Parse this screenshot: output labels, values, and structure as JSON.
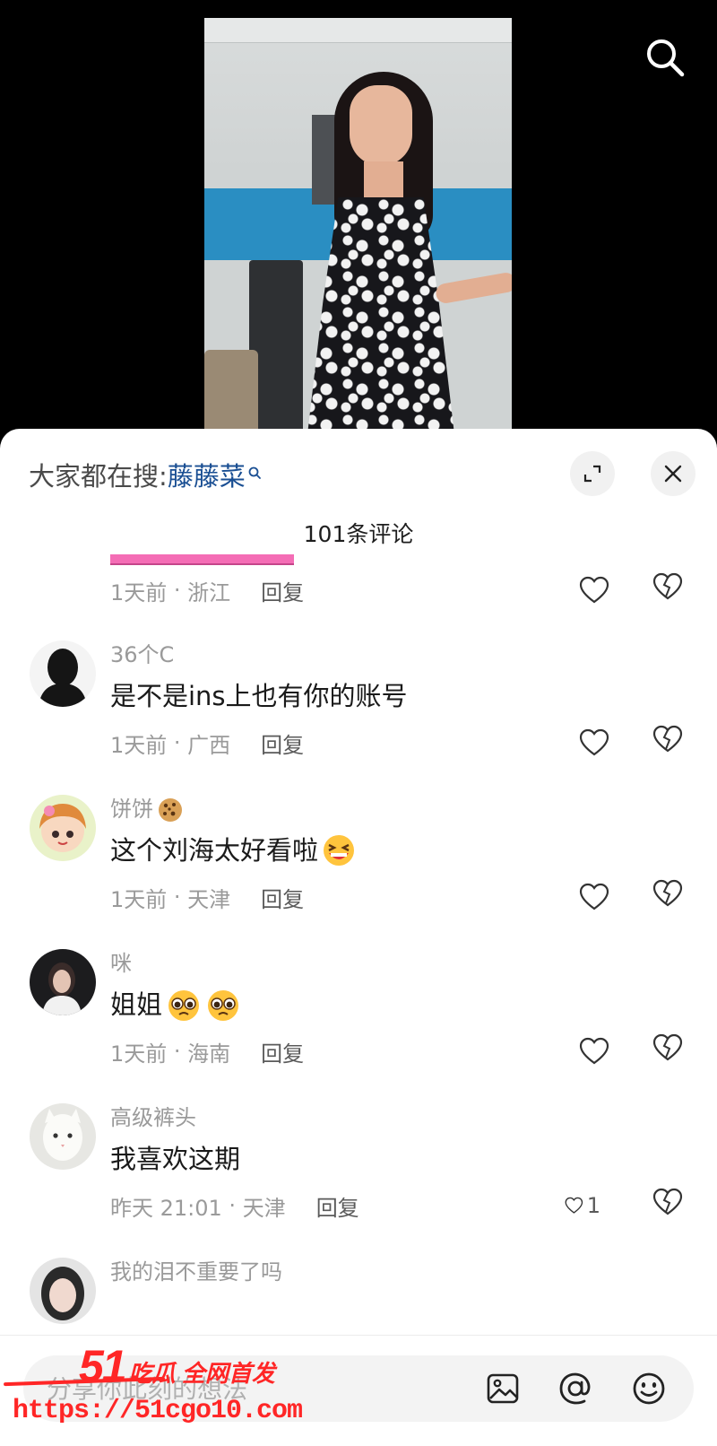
{
  "video": {
    "search_icon": "search-icon"
  },
  "sheet": {
    "hot_search_label": "大家都在搜:",
    "hot_search_keyword": "藤藤菜",
    "comment_count": "101条评论",
    "reply_label": "回复"
  },
  "comments": {
    "partial": {
      "time": "1天前",
      "location": "浙江"
    },
    "items": [
      {
        "user": "36个C",
        "text": "是不是ins上也有你的账号",
        "time": "1天前",
        "location": "广西",
        "likes": ""
      },
      {
        "user": "饼饼",
        "user_emoji": "cookie",
        "text": "这个刘海太好看啦",
        "text_emoji": "laughing-face",
        "time": "1天前",
        "location": "天津",
        "likes": ""
      },
      {
        "user": "咪",
        "text": "姐姐",
        "text_emoji": "pleading-face x2",
        "time": "1天前",
        "location": "海南",
        "likes": ""
      },
      {
        "user": "高级裤头",
        "text": "我喜欢这期",
        "time": "昨天 21:01",
        "location": "天津",
        "likes": "1"
      },
      {
        "user": "我的泪不重要了吗"
      }
    ]
  },
  "input": {
    "placeholder": "分享你此刻的想法"
  },
  "watermark": {
    "logo_number": "51",
    "logo_text": "吃瓜 全网首发",
    "url": "https://51cgo10.com"
  },
  "colors": {
    "keyword": "#1a4f93",
    "watermark": "#ff2626",
    "sheet_bg": "#ffffff"
  }
}
